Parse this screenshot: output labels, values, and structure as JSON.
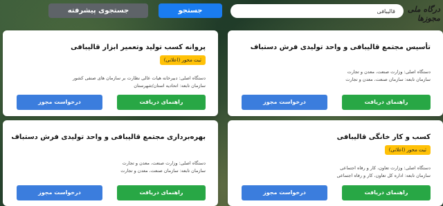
{
  "header": {
    "logo_text": "درگاه ملی مجوزها",
    "search_value": "قالیبافی",
    "search_button": "جستجو",
    "advanced_button": "جستجوی پیشرفته"
  },
  "cards": [
    {
      "title": "تأسیس مجتمع قالیبافی و واحد تولیدی فرش دستباف",
      "badge": "",
      "origin": "دستگاه اصلی: وزارت صنعت، معدن و تجارت",
      "affiliate": "سازمان تابعه: سازمان صنعت، معدن و تجارت",
      "guide_button": "راهنمای دریافت",
      "request_button": "درخواست مجوز"
    },
    {
      "title": "پروانه کسب تولید وتعمیر ابزار قالیبافی",
      "badge": "ثبت محور (اعلانی)",
      "origin": "دستگاه اصلی: دبیرخانه هیات عالی نظارت بر سازمان های صنفی کشور",
      "affiliate": "سازمان تابعه: اتحادیه استان/شهرستان",
      "guide_button": "راهنمای دریافت",
      "request_button": "درخواست مجوز"
    },
    {
      "title": "کسب و کار خانگی قالیبافی",
      "badge": "ثبت محور (اعلانی)",
      "origin": "دستگاه اصلی: وزارت تعاون، کار و رفاه اجتماعی",
      "affiliate": "سازمان تابعه: اداره کل تعاون، کار و رفاه اجتماعی",
      "guide_button": "راهنمای دریافت",
      "request_button": "درخواست مجوز"
    },
    {
      "title": "بهره‌برداری مجتمع قالیبافی و واحد تولیدی فرش دستباف",
      "badge": "",
      "origin": "دستگاه اصلی: وزارت صنعت، معدن و تجارت",
      "affiliate": "سازمان تابعه: سازمان صنعت، معدن و تجارت",
      "guide_button": "راهنمای دریافت",
      "request_button": "درخواست مجوز"
    }
  ]
}
